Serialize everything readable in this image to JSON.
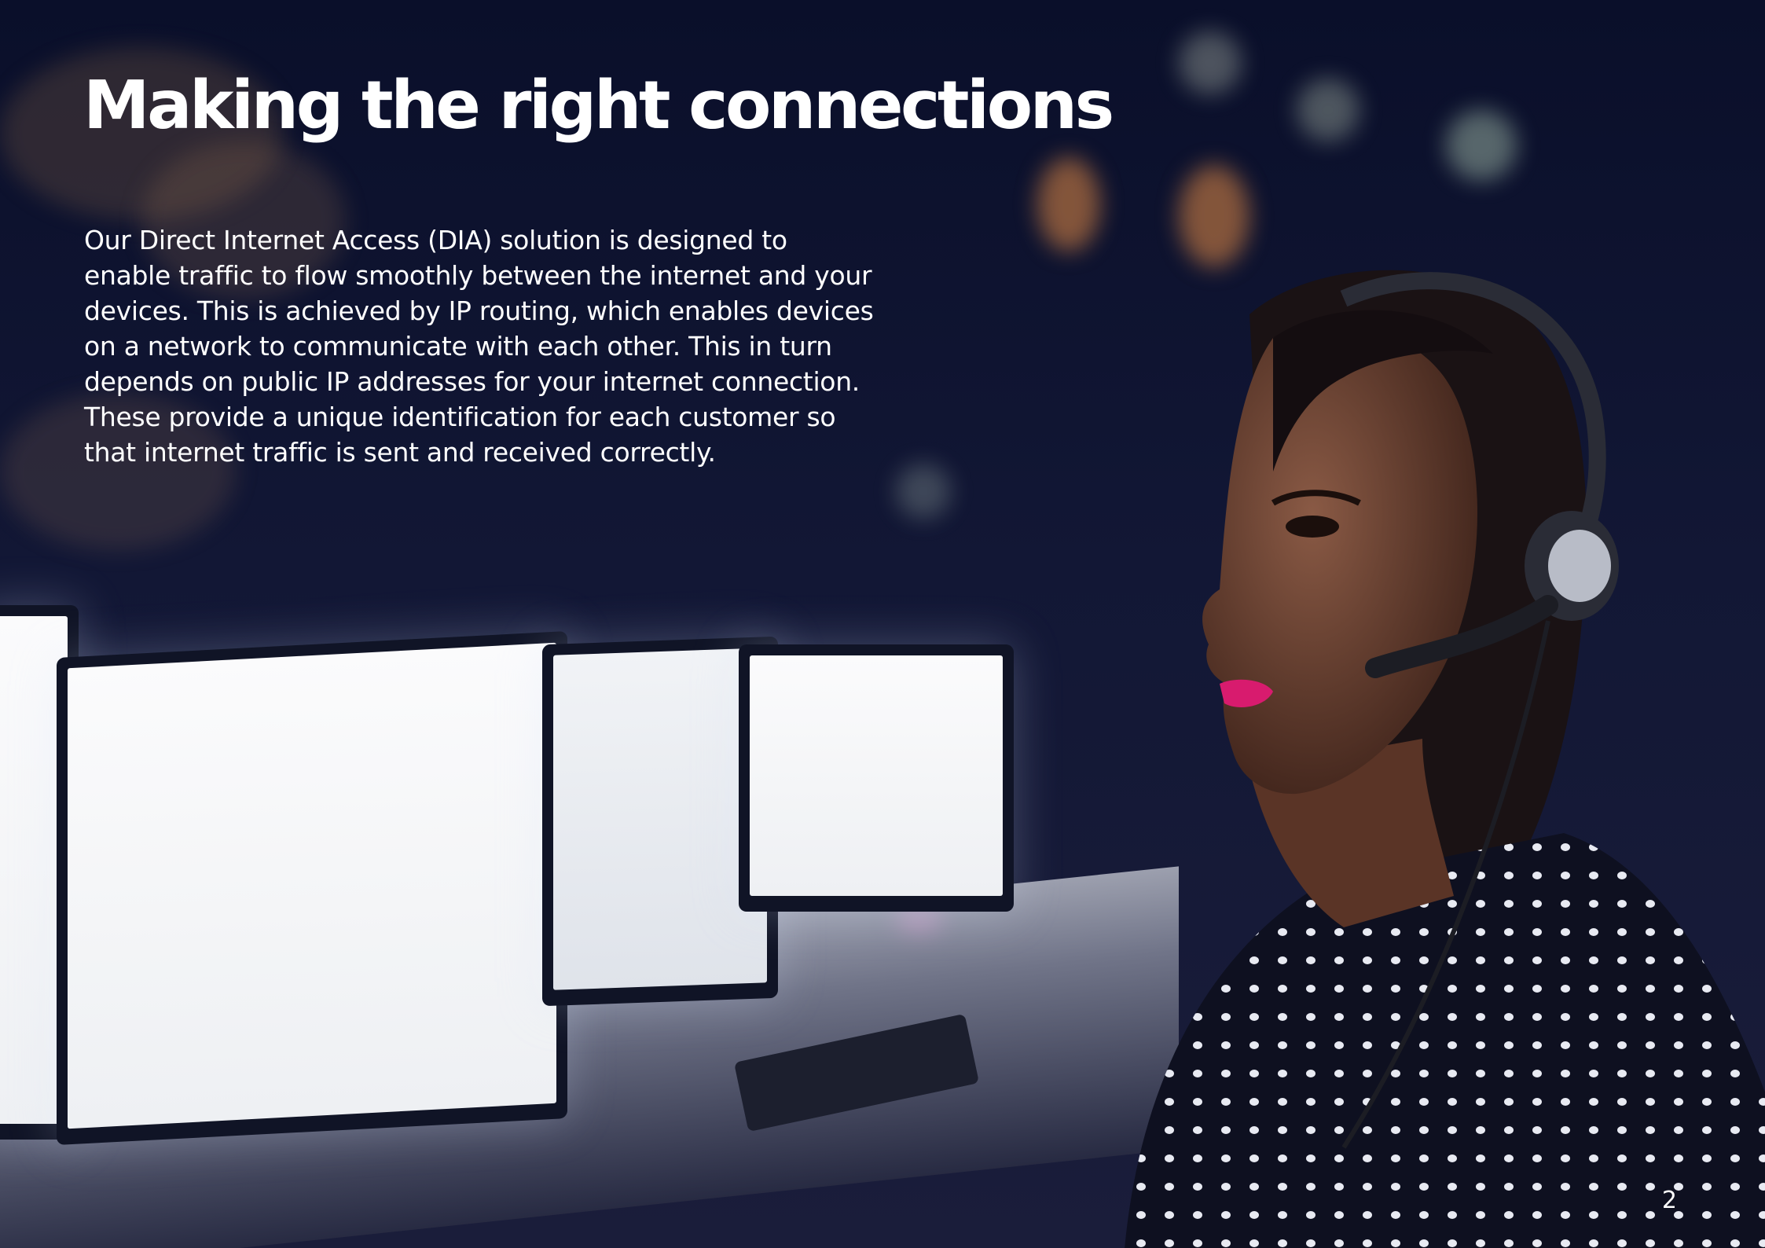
{
  "page": {
    "title": "Making the right connections",
    "body": "Our Direct Internet Access (DIA) solution is designed to enable traffic to flow smoothly between the internet and your devices. This is achieved by IP routing, which enables devices on a network to communicate with each other. This in turn depends on public IP addresses for your internet connection. These provide a unique identification for each customer so that internet traffic is sent and received correctly.",
    "page_number": "2"
  },
  "colors": {
    "background": "#0d1230",
    "text": "#ffffff",
    "lipstick": "#d81b6e"
  }
}
